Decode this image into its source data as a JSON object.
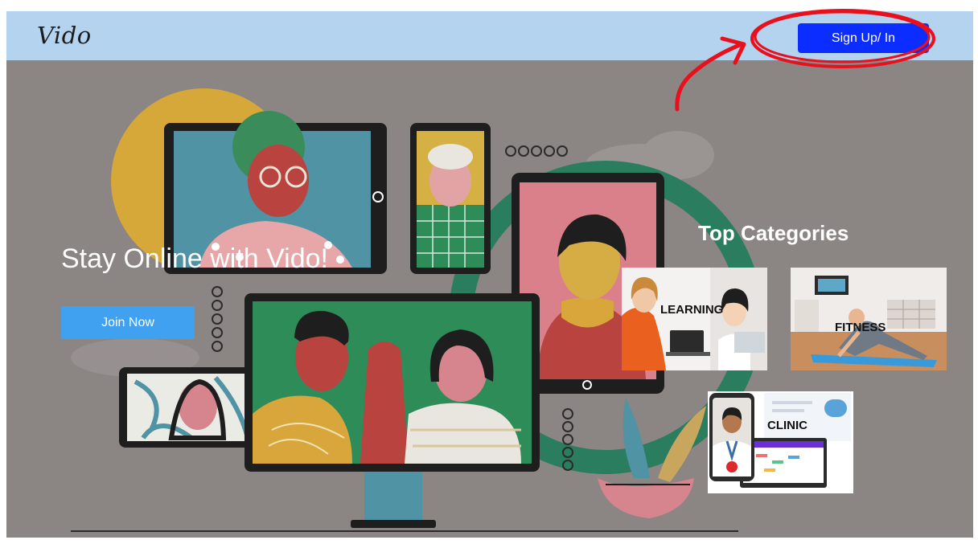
{
  "header": {
    "logo": "Vido",
    "signup_label": "Sign Up/ In"
  },
  "hero": {
    "headline": "Stay Online with Vido!",
    "join_label": "Join Now"
  },
  "categories": {
    "heading": "Top Categories",
    "items": [
      {
        "label": "LEARNING"
      },
      {
        "label": "FITNESS"
      },
      {
        "label": "CLINIC"
      }
    ]
  },
  "colors": {
    "navbar": "#b4d3ee",
    "signup": "#0b2dff",
    "join": "#3fa1ef",
    "hero_bg": "#8b8583",
    "annotation": "#e8101c"
  }
}
